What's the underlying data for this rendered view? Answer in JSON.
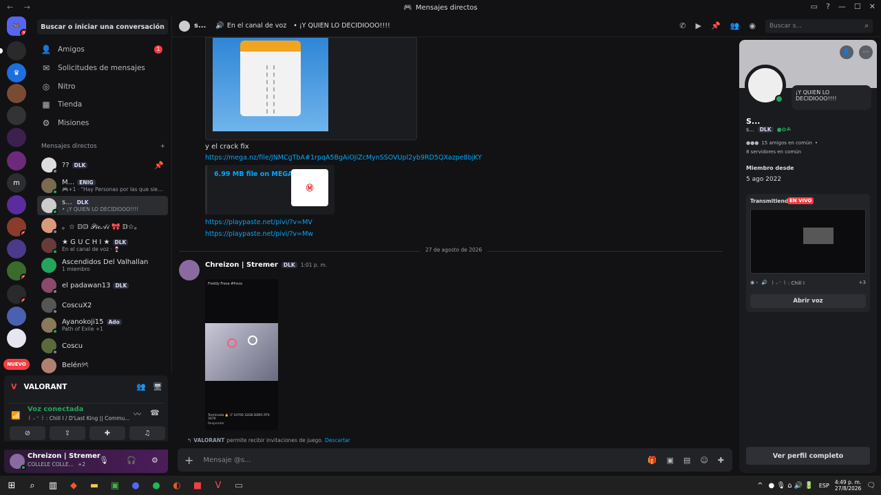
{
  "window": {
    "title": "Mensajes directos"
  },
  "sidebar": {
    "search_label": "Buscar o iniciar una conversación",
    "nav": [
      {
        "label": "Amigos",
        "icon": "friends-icon",
        "badge": "1"
      },
      {
        "label": "Solicitudes de mensajes",
        "icon": "mail-icon"
      },
      {
        "label": "Nitro",
        "icon": "nitro-icon"
      },
      {
        "label": "Tienda",
        "icon": "shop-icon"
      },
      {
        "label": "Misiones",
        "icon": "quests-icon"
      }
    ],
    "dm_header": "Mensajes directos",
    "dms": [
      {
        "name": "??",
        "tag": "DLK",
        "sub": ""
      },
      {
        "name": "M...",
        "tag": "ENIG",
        "sub": "🎮+1 · \"Hay Personas por las que siemp..."
      },
      {
        "name": "s...",
        "tag": "DLK",
        "sub": "• ¡Y QUIEN LO DECIDIOOO!!!!"
      },
      {
        "name": "﻿。☆ 𝔻𝔻 𝒫𝒾𝒸𝒜𝒾 🎀 𝔻☆。",
        "tag": "",
        "sub": ""
      },
      {
        "name": "★ G U C H I ★",
        "tag": "DLK",
        "sub": "En el canal de voz · 🍷"
      },
      {
        "name": "Ascendidos Del Valhallan",
        "tag": "",
        "sub": "1 miembro"
      },
      {
        "name": "el padawan13",
        "tag": "DLK",
        "sub": ""
      },
      {
        "name": "CoscuX2",
        "tag": "",
        "sub": ""
      },
      {
        "name": "Ayanokoji15",
        "tag": "Ado",
        "sub": "Path of Exile +1"
      },
      {
        "name": "Coscu",
        "tag": "",
        "sub": ""
      },
      {
        "name": "Belén୨ৎ",
        "tag": "",
        "sub": ""
      }
    ]
  },
  "guilds": {
    "new_label": "NUEVO",
    "letter_m": "m"
  },
  "voice": {
    "game": "VALORANT",
    "status": "Voz conectada",
    "channel": "꒰ ˶ ᵔ ꒱ : Chill I / D'Last King || Commu..."
  },
  "user": {
    "name": "Chreizon | Stremer",
    "status": "COLLELE COLLE...",
    "extra": "+2"
  },
  "header": {
    "name": "s...",
    "voice_label": "En el canal de voz",
    "status": "• ¡Y QUIEN LO DECIDIOOO!!!!",
    "search_placeholder": "Buscar s..."
  },
  "chat": {
    "crack_text": "y el crack fix",
    "mega_link": "https://mega.nz/file/JNMCgTbA#1rpqA5BgAiOJiZcMynSSOVUpl2yb9RD5QXazpe8bjKY",
    "mega_embed": "6.99 MB file on MEGA",
    "link1": "https://playpaste.net/pivi/?v=MV",
    "link2": "https://playpaste.net/pivi/?v=Mw",
    "date_divider": "27 de agosto de 2026",
    "msg_author": "Chreizon | Stremer",
    "msg_tag": "DLK",
    "msg_time": "1:01 p. m.",
    "shot_title": "Freddy Fresa #freza",
    "shot_caption": "Terminada 🔥 i7 10700 32GB DDR5 RTX 3070",
    "shot_reply": "Responder",
    "invite_game": "VALORANT",
    "invite_text": "permite recibir invitaciones de juego.",
    "invite_dismiss": "Descartar",
    "composer_placeholder": "Mensaje @s..."
  },
  "profile": {
    "status_bubble": "¡Y QUIEN LO DECIDIOOO!!!!",
    "name": "S...",
    "username": "s...",
    "tag": "DLK",
    "mutual_friends": "15 amigos en común",
    "mutual_servers": "8 servidores en común",
    "member_since_label": "Miembro desde",
    "member_since": "5 ago 2022",
    "streaming_label": "Transmitiendo",
    "live_label": "EN VIVO",
    "stream_channel": "꒰ ˶ ᵔ ꒱ : Chill I",
    "stream_extra": "+3",
    "open_voice": "Abrir voz",
    "full_profile": "Ver perfil completo"
  },
  "taskbar": {
    "lang": "ESP",
    "time": "4:49 p. m.",
    "date": "27/8/2026"
  },
  "colors": {
    "accent": "#5865f2",
    "link": "#00a8fc",
    "online": "#23a55a",
    "danger": "#f23f43",
    "live": "#f23f43"
  }
}
